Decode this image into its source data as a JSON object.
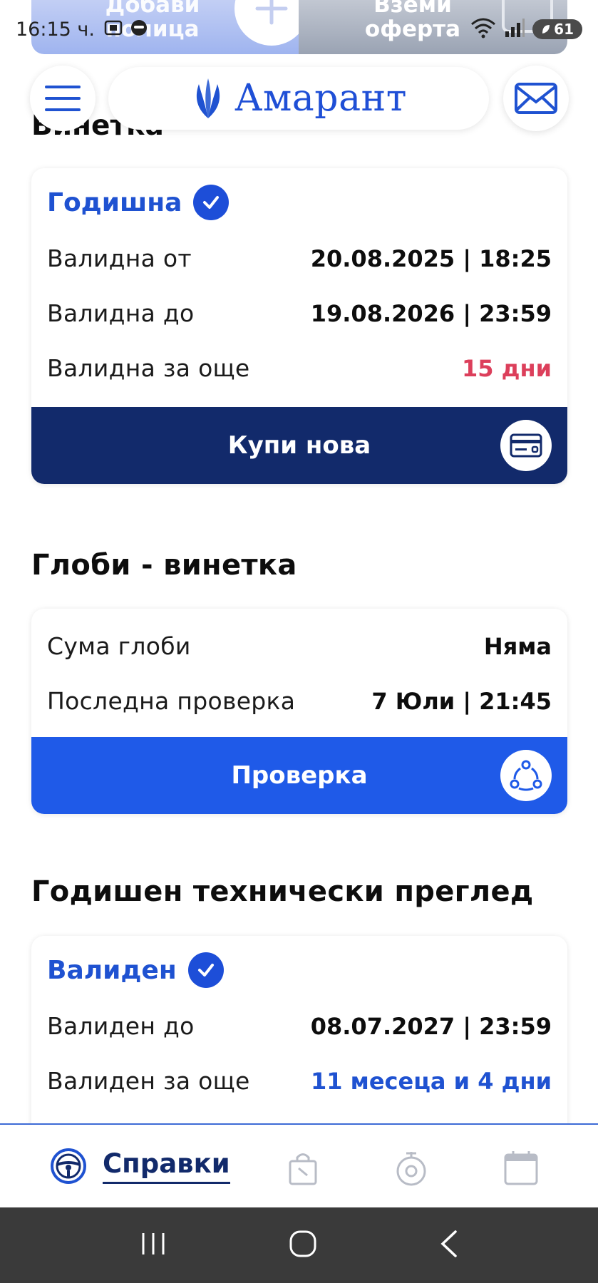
{
  "promo": {
    "left_text": "Добави\nполица",
    "right_text": "Вземи\nоферта"
  },
  "status_bar": {
    "time": "16:15 ч.",
    "battery": "61"
  },
  "header": {
    "logo_text": "Амарант"
  },
  "vignette": {
    "heading": "Винетка",
    "status": "Годишна",
    "rows": [
      {
        "label": "Валидна от",
        "value": "20.08.2025 | 18:25"
      },
      {
        "label": "Валидна до",
        "value": "19.08.2026 | 23:59"
      },
      {
        "label": "Валидна за още",
        "value": "15 дни"
      }
    ],
    "action_label": "Купи нова"
  },
  "fines": {
    "heading": "Глоби - винетка",
    "rows": [
      {
        "label": "Сума глоби",
        "value": "Няма"
      },
      {
        "label": "Последна проверка",
        "value": "7 Юли | 21:45"
      }
    ],
    "action_label": "Проверка"
  },
  "inspection": {
    "heading": "Годишен технически преглед",
    "status": "Валиден",
    "rows": [
      {
        "label": "Валиден до",
        "value": "08.07.2027 | 23:59"
      },
      {
        "label": "Валиден за още",
        "value": "11 месеца и 4 дни"
      }
    ]
  },
  "tabs": {
    "active_label": "Справки"
  },
  "colors": {
    "brand_blue": "#1f52d1",
    "navy": "#122a6b",
    "bright_blue": "#1f5ae8",
    "alert_red": "#dc3f5b"
  }
}
